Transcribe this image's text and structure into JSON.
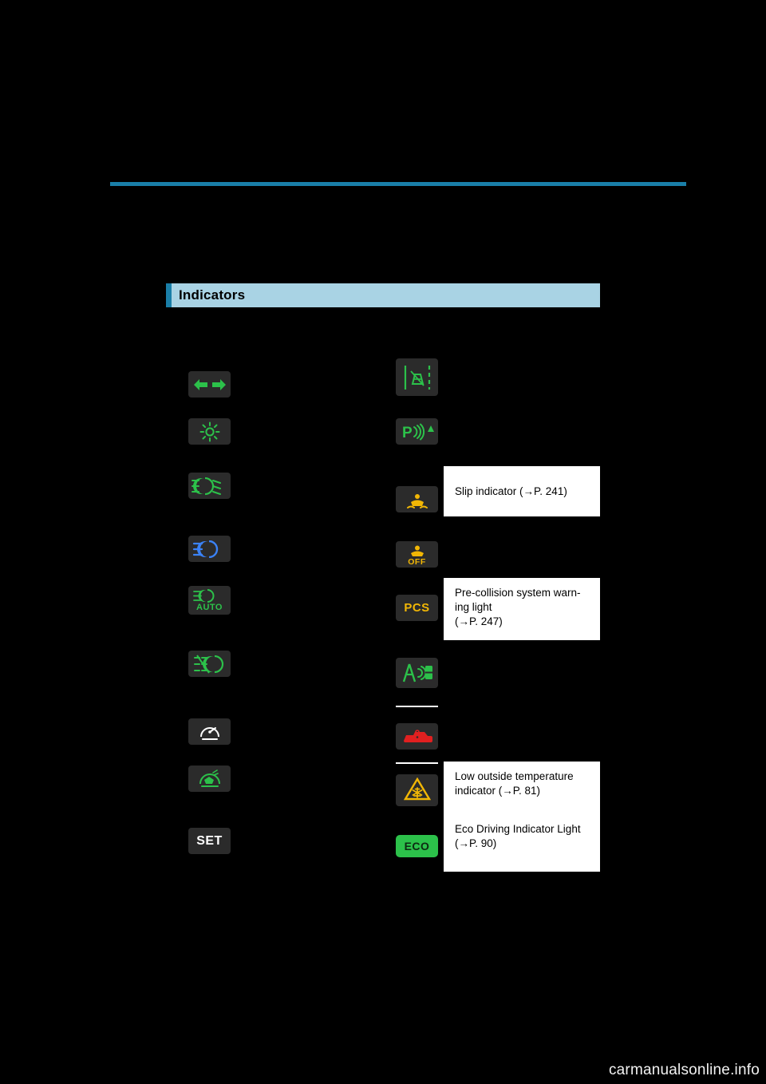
{
  "page": {
    "section_title": "Indicators",
    "background_color": "#000000",
    "accent_color": "#1a7fa8",
    "header_bar_color": "#a9d3e4"
  },
  "left_column": {
    "items": [
      {
        "icon": "turn-signal-arrows-icon",
        "color": "#2cc14a",
        "label": ""
      },
      {
        "icon": "tail-light-icon",
        "color": "#2cc14a",
        "label": ""
      },
      {
        "icon": "headlight-low-beam-icon",
        "color": "#2cc14a",
        "label": ""
      },
      {
        "icon": "headlight-high-beam-icon",
        "color": "#3b82f6",
        "label": ""
      },
      {
        "icon": "automatic-high-beam-icon",
        "color": "#2cc14a",
        "label": "AUTO"
      },
      {
        "icon": "front-fog-light-icon",
        "color": "#2cc14a",
        "label": ""
      },
      {
        "icon": "cruise-control-icon",
        "color": "#ffffff",
        "label": ""
      },
      {
        "icon": "dynamic-radar-cruise-control-icon",
        "color": "#2cc14a",
        "label": ""
      },
      {
        "icon": "set-indicator-icon",
        "color": "#ffffff",
        "label": "SET"
      }
    ]
  },
  "right_column": {
    "items": [
      {
        "icon": "lane-departure-alert-icon",
        "color": "#2cc14a",
        "label": "",
        "callout": null
      },
      {
        "icon": "intuitive-parking-assist-icon",
        "color": "#2cc14a",
        "label": "P",
        "callout": null
      },
      {
        "icon": "slip-indicator-icon",
        "color": "#f2b705",
        "label": "",
        "callout": {
          "text": "Slip indicator (→P. 241)"
        }
      },
      {
        "icon": "vsc-off-indicator-icon",
        "color": "#f2b705",
        "label": "OFF",
        "callout": null
      },
      {
        "icon": "pcs-warning-icon",
        "color": "#f2b705",
        "label": "PCS",
        "callout": {
          "text": "Pre-collision  system  warn-\ning light\n(→P. 247)"
        }
      },
      {
        "icon": "lkas-lane-keeping-icon",
        "color": "#2cc14a",
        "label": "",
        "callout": null
      },
      {
        "icon": "security-indicator-icon",
        "color": "#e02020",
        "label": "",
        "callout": null
      },
      {
        "icon": "low-outside-temperature-icon",
        "color": "#f2b705",
        "label": "",
        "callout": {
          "text": "Low  outside  temperature\nindicator (→P. 81)"
        }
      },
      {
        "icon": "eco-driving-indicator-icon",
        "color": "#2cc14a",
        "label": "ECO",
        "callout": {
          "text": "Eco Driving Indicator Light\n(→P. 90)"
        }
      }
    ]
  },
  "callouts": {
    "slip": "Slip indicator (→P. 241)",
    "pcs_line1": "Pre-collision  system  warn-",
    "pcs_line2": "ing light",
    "pcs_line3": "(→P. 247)",
    "low_temp_line1": "Low  outside  temperature",
    "low_temp_line2": "indicator (→P. 81)",
    "eco_line1": "Eco Driving Indicator Light",
    "eco_line2": "(→P. 90)"
  },
  "watermark": {
    "text": "carmanualsonline",
    "suffix": ".info"
  }
}
